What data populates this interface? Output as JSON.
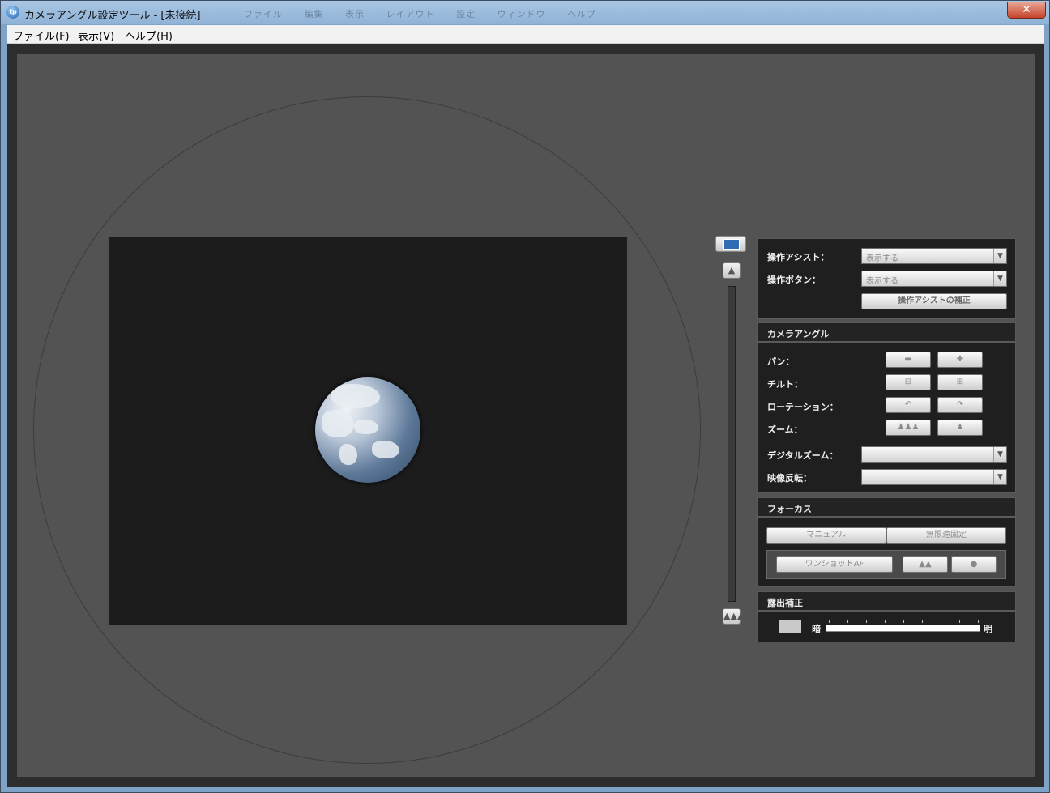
{
  "window": {
    "title": "カメラアングル設定ツール - [未接続]",
    "ghost_menu": [
      "ファイル",
      "編集",
      "表示",
      "レイアウト",
      "設定",
      "ウィンドウ",
      "ヘルプ"
    ],
    "close_label": "✕"
  },
  "menubar": {
    "items": [
      "ファイル(F)",
      "表示(V)",
      "ヘルプ(H)"
    ]
  },
  "zoom": {
    "fit_icon": "fit-view-icon",
    "tele_icon": "zoom-tele-icon",
    "wide_icon": "zoom-wide-icon"
  },
  "assist": {
    "op_assist_label": "操作アシスト：",
    "op_assist_value": "表示する",
    "op_button_label": "操作ボタン：",
    "op_button_value": "表示する",
    "correct_button": "操作アシストの補正"
  },
  "camera_angle": {
    "header": "カメラアングル",
    "pan_label": "パン：",
    "tilt_label": "チルト：",
    "rotation_label": "ローテーション：",
    "zoom_label": "ズーム：",
    "digital_zoom_label": "デジタルズーム：",
    "digital_zoom_value": "",
    "flip_label": "映像反転：",
    "flip_value": ""
  },
  "focus": {
    "header": "フォーカス",
    "manual_button": "マニュアル",
    "infinity_button": "無限遠固定",
    "oneshot_button": "ワンショットAF"
  },
  "exposure": {
    "header": "露出補正",
    "dark_label": "暗",
    "bright_label": "明"
  }
}
